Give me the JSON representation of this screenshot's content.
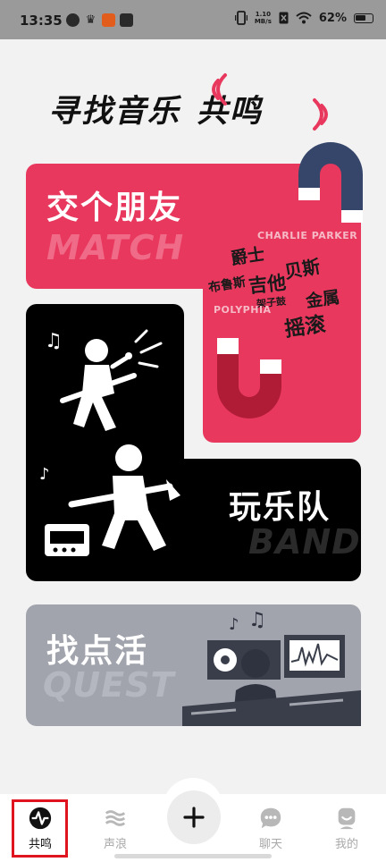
{
  "status_bar": {
    "time": "13:35",
    "net_speed_value": "1.10",
    "net_speed_unit": "MB/s",
    "battery": "62%"
  },
  "headline": {
    "part1": "寻找音乐",
    "part2": "共鸣"
  },
  "cards": {
    "match": {
      "title": "交个朋友",
      "en": "MATCH",
      "tags": [
        "CHARLIE PARKER",
        "爵士",
        "贝斯",
        "吉他",
        "金属",
        "布鲁斯",
        "架子鼓",
        "POLYPHIA",
        "摇滚"
      ]
    },
    "band": {
      "title": "玩乐队",
      "en": "BAND"
    },
    "quest": {
      "title": "找点活",
      "en": "QUEST"
    }
  },
  "tabbar": {
    "items": [
      {
        "label": "共鸣",
        "icon": "resonance-icon"
      },
      {
        "label": "声浪",
        "icon": "wave-icon"
      },
      {
        "label": "聊天",
        "icon": "chat-icon"
      },
      {
        "label": "我的",
        "icon": "profile-icon"
      }
    ],
    "center_icon": "plus-icon"
  },
  "colors": {
    "match": "#e8385e",
    "band": "#000000",
    "quest": "#a1a4ad",
    "active_outline": "#e0141e"
  }
}
